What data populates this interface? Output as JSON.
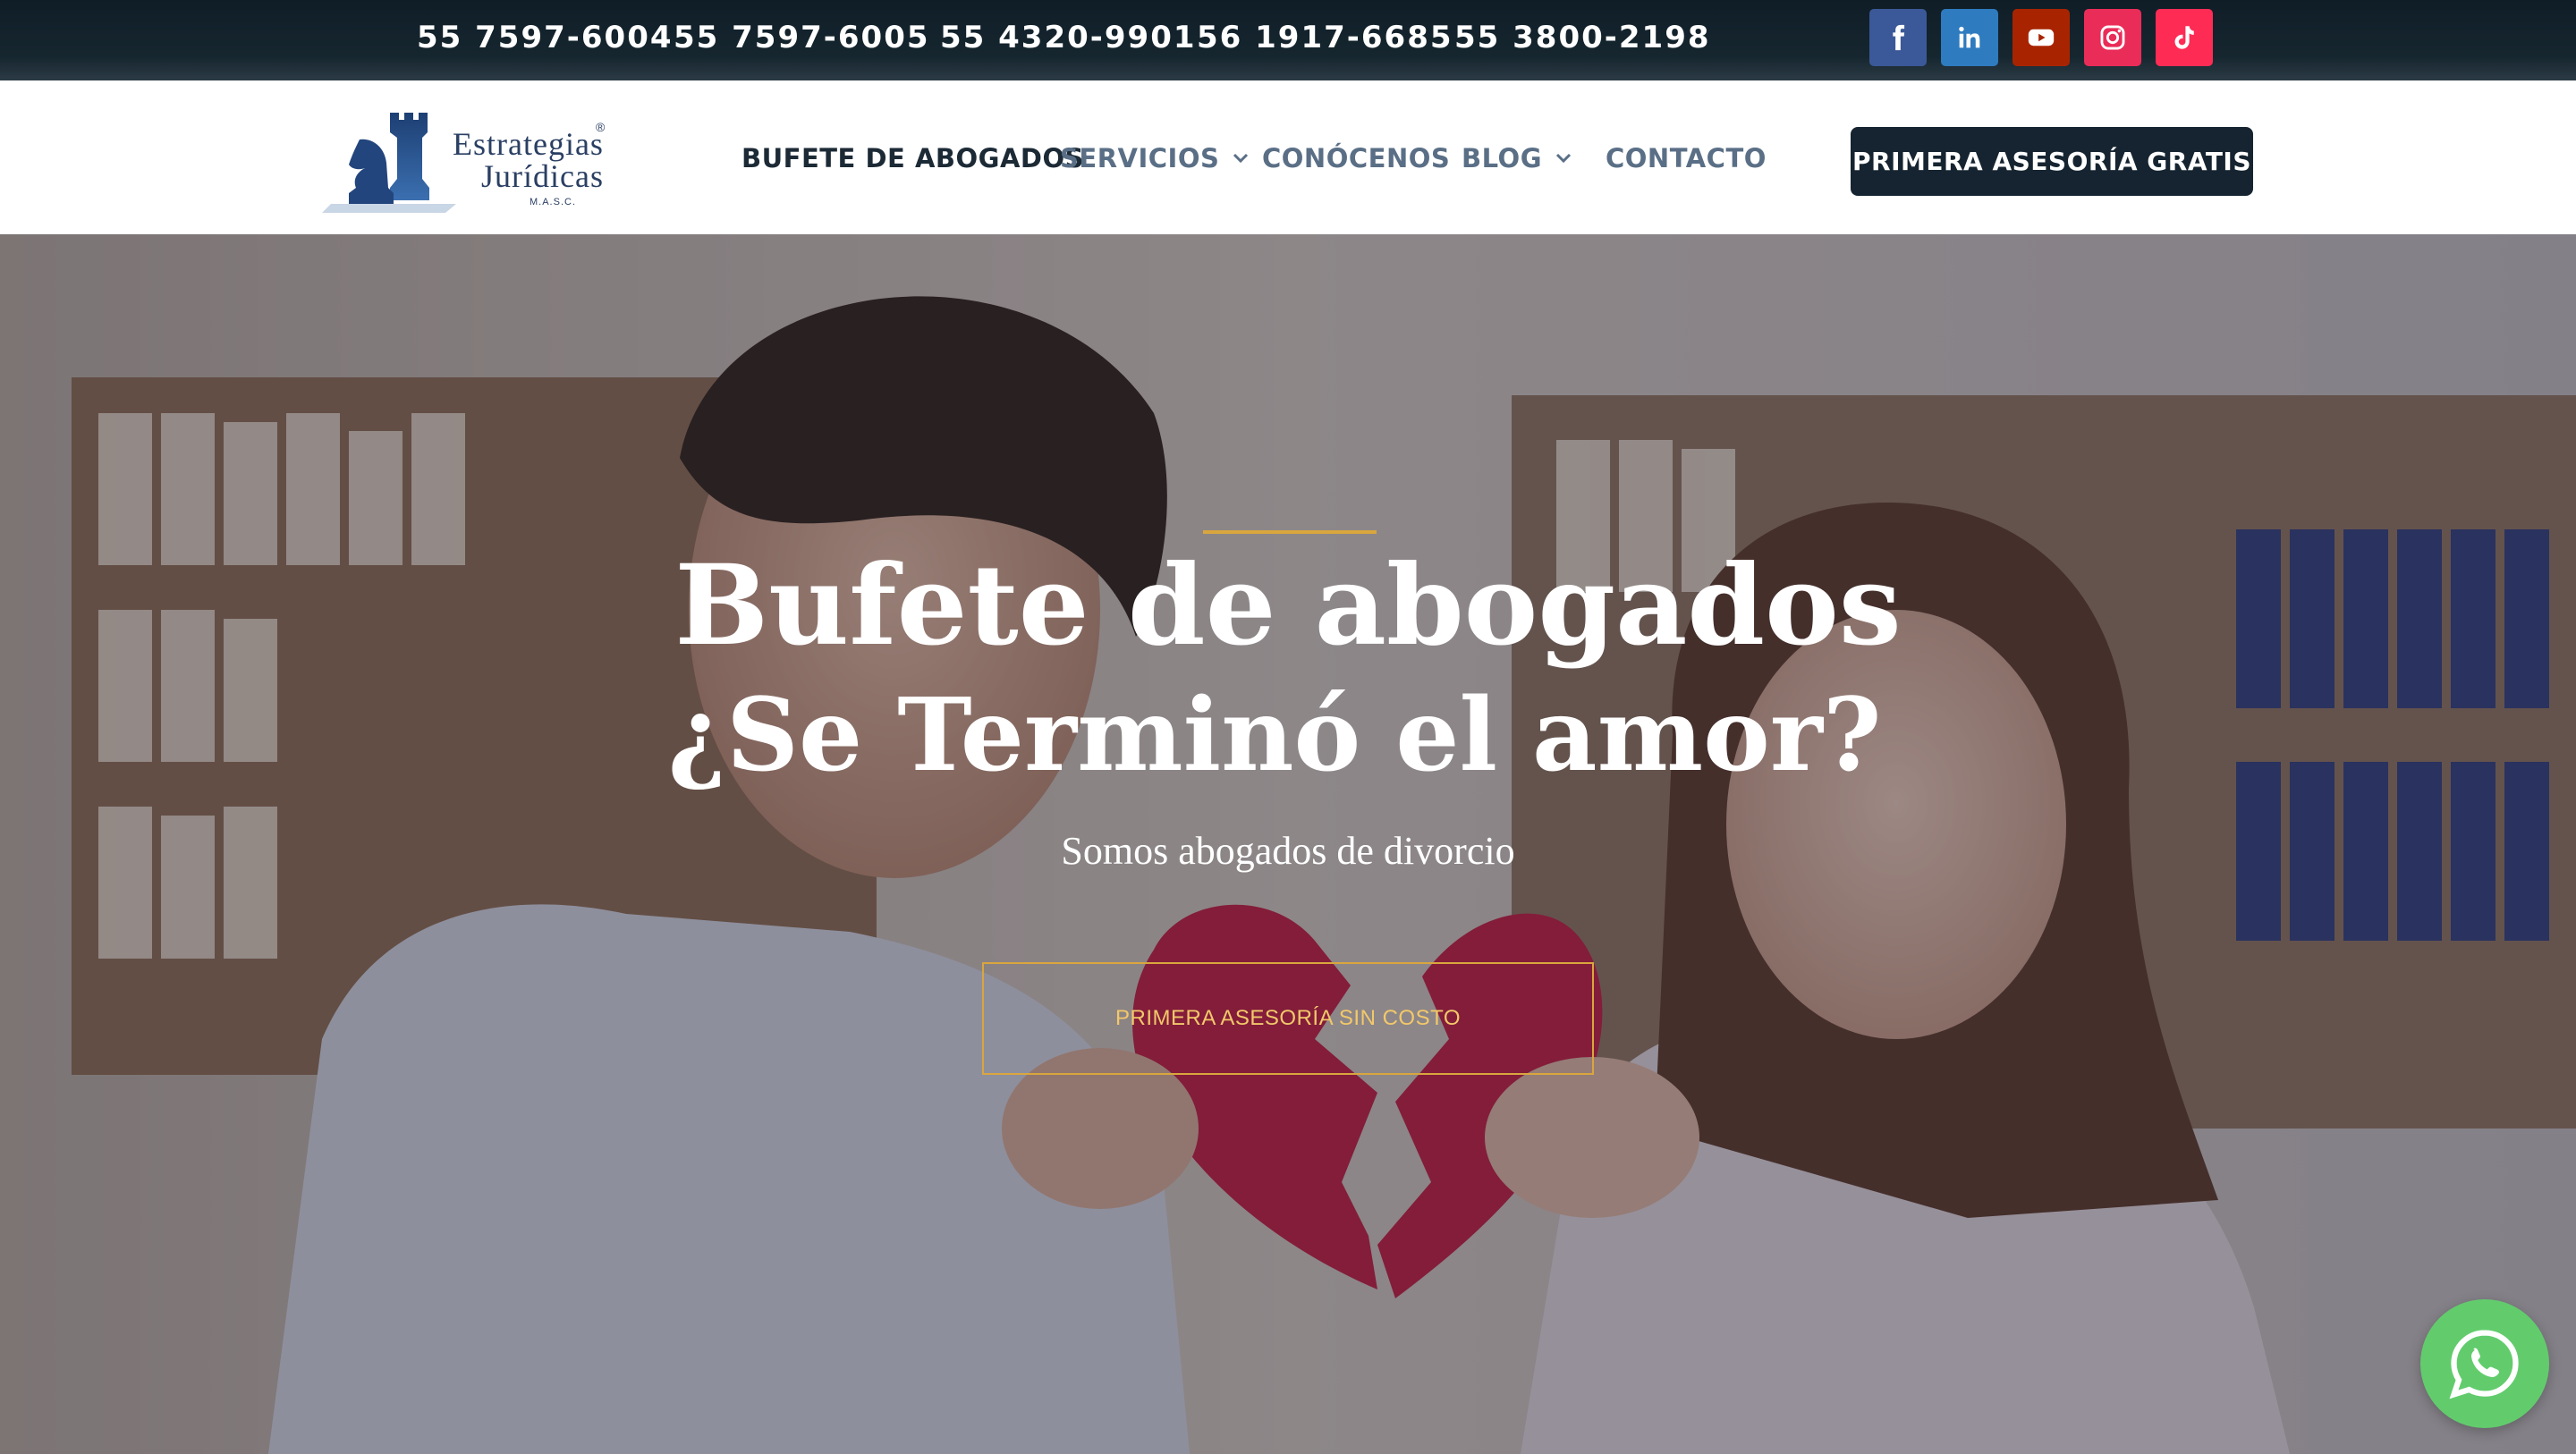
{
  "topbar": {
    "phones": [
      "55 7597-6004",
      "55 7597-6005",
      "55 4320-9901",
      "56 1917-6685",
      "55 3800-2198"
    ],
    "socials": [
      {
        "name": "facebook",
        "color": "#3b5998"
      },
      {
        "name": "linkedin",
        "color": "#2e7bbf"
      },
      {
        "name": "youtube",
        "color": "#a82400"
      },
      {
        "name": "instagram",
        "color": "#ea2c59"
      },
      {
        "name": "tiktok",
        "color": "#fe2c55"
      }
    ]
  },
  "header": {
    "logo": {
      "line1": "Estrategias",
      "line2": "Jurídicas",
      "reg": "®",
      "masc": "M.A.S.C."
    },
    "nav": [
      {
        "label": "BUFETE DE ABOGADOS",
        "active": true
      },
      {
        "label": "SERVICIOS",
        "dropdown": true
      },
      {
        "label": "CONÓCENOS"
      },
      {
        "label": "BLOG",
        "dropdown": true
      },
      {
        "label": "CONTACTO"
      }
    ],
    "cta_label": "PRIMERA ASESORÍA GRATIS"
  },
  "hero": {
    "title": "Bufete de abogados",
    "subtitle": "¿Se Terminó el amor?",
    "tagline": "Somos abogados de divorcio",
    "button_label": "PRIMERA ASESORÍA SIN COSTO",
    "accent_color": "#d9a63e"
  },
  "floating": {
    "whatsapp_icon": "whatsapp-icon"
  }
}
